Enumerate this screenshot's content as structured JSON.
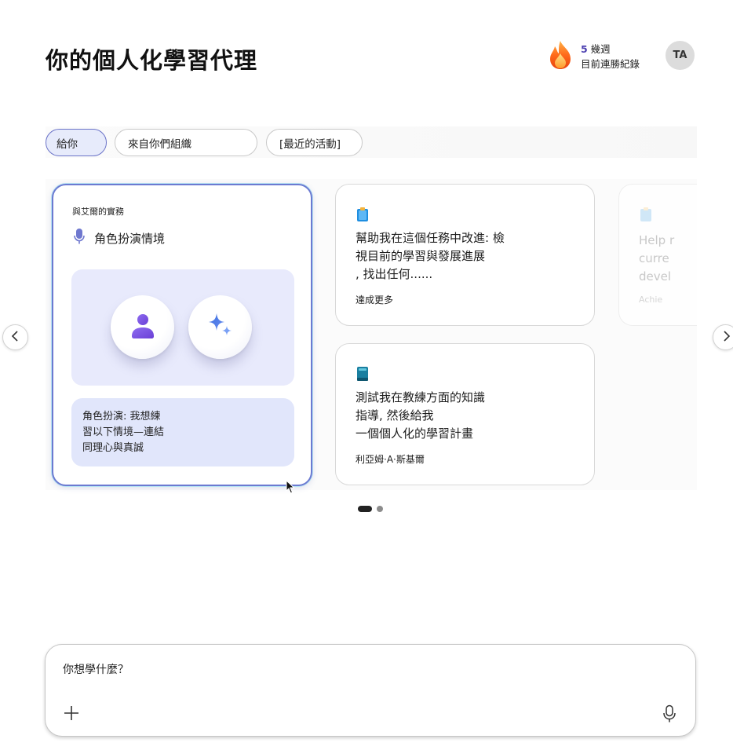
{
  "header": {
    "title": "你的個人化學習代理",
    "streak": {
      "count": "5",
      "unit": " 幾週",
      "label": "目前連勝紀錄"
    },
    "avatar_initials": "TA"
  },
  "tabs": [
    {
      "label": "給你",
      "active": true
    },
    {
      "label": "來自你們組織",
      "active": false
    },
    {
      "label": "[最近的活動]",
      "active": false
    }
  ],
  "cards": {
    "featured": {
      "header": "與艾爾的實務",
      "subtitle": "角色扮演情境",
      "description_lines": [
        "角色扮演: 我想練",
        "習以下情境—連結",
        "同理心與真誠"
      ]
    },
    "items": [
      {
        "icon": "clipboard-icon",
        "title_lines": [
          "幫助我在這個任務中改進: 檢",
          "視目前的學習與發展進展",
          ", 找出任何......"
        ],
        "meta": "達成更多"
      },
      {
        "icon": "book-icon",
        "title_lines": [
          "測試我在教練方面的知識",
          "指導, 然後給我",
          "一個個人化的學習計畫"
        ],
        "meta": "利亞姆·A·斯基爾"
      }
    ],
    "ghost": {
      "title_lines": [
        "Help r",
        "curre",
        "devel"
      ],
      "meta": "Achie"
    }
  },
  "pagination": {
    "pages": 2,
    "current": 1
  },
  "chat": {
    "placeholder": "你想學什麼？"
  },
  "colors": {
    "accent": "#6c7ad1",
    "active_tab_bg": "#e7ebfb",
    "illustration_bg": "#e8eafc",
    "streak_count": "#4b3fb0",
    "flame": "#ff6a1a"
  }
}
